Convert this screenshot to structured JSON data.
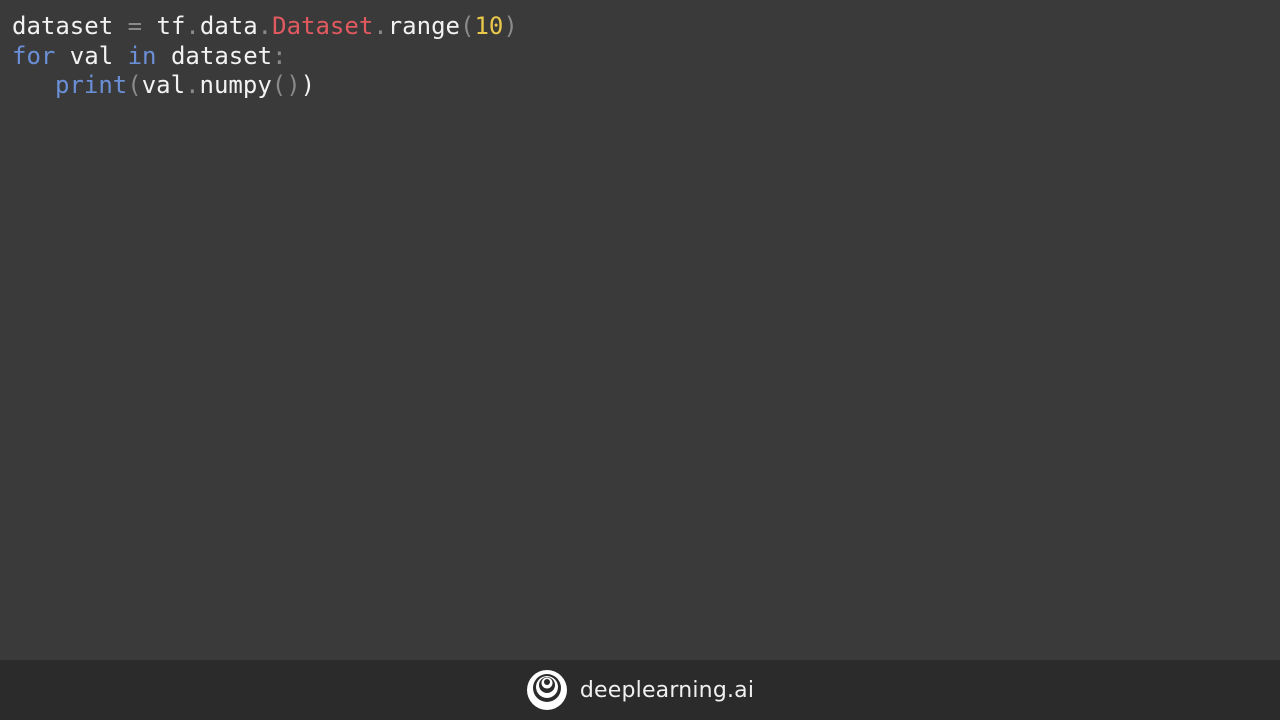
{
  "code": {
    "line1": {
      "t1": "dataset",
      "t2": " = ",
      "t3": "tf",
      "t4": ".",
      "t5": "data",
      "t6": ".",
      "t7": "Dataset",
      "t8": ".",
      "t9": "range",
      "t10": "(",
      "t11": "10",
      "t12": ")"
    },
    "line2": {
      "t1": "for",
      "t2": " val ",
      "t3": "in",
      "t4": " dataset",
      "t5": ":"
    },
    "line3": {
      "t1": "print",
      "t2": "(",
      "t3": "val",
      "t4": ".",
      "t5": "numpy",
      "t6": "()",
      "t7": ")"
    }
  },
  "footer": {
    "brand": "deeplearning.ai",
    "logo_icon": "deeplearning-logo-icon"
  },
  "colors": {
    "background": "#3a3a3a",
    "footer_background": "#2b2b2b",
    "keyword": "#6b8fd6",
    "class": "#e05a5f",
    "number": "#e9c84a",
    "operator": "#8a8a8a",
    "text": "#f2f2f2"
  }
}
